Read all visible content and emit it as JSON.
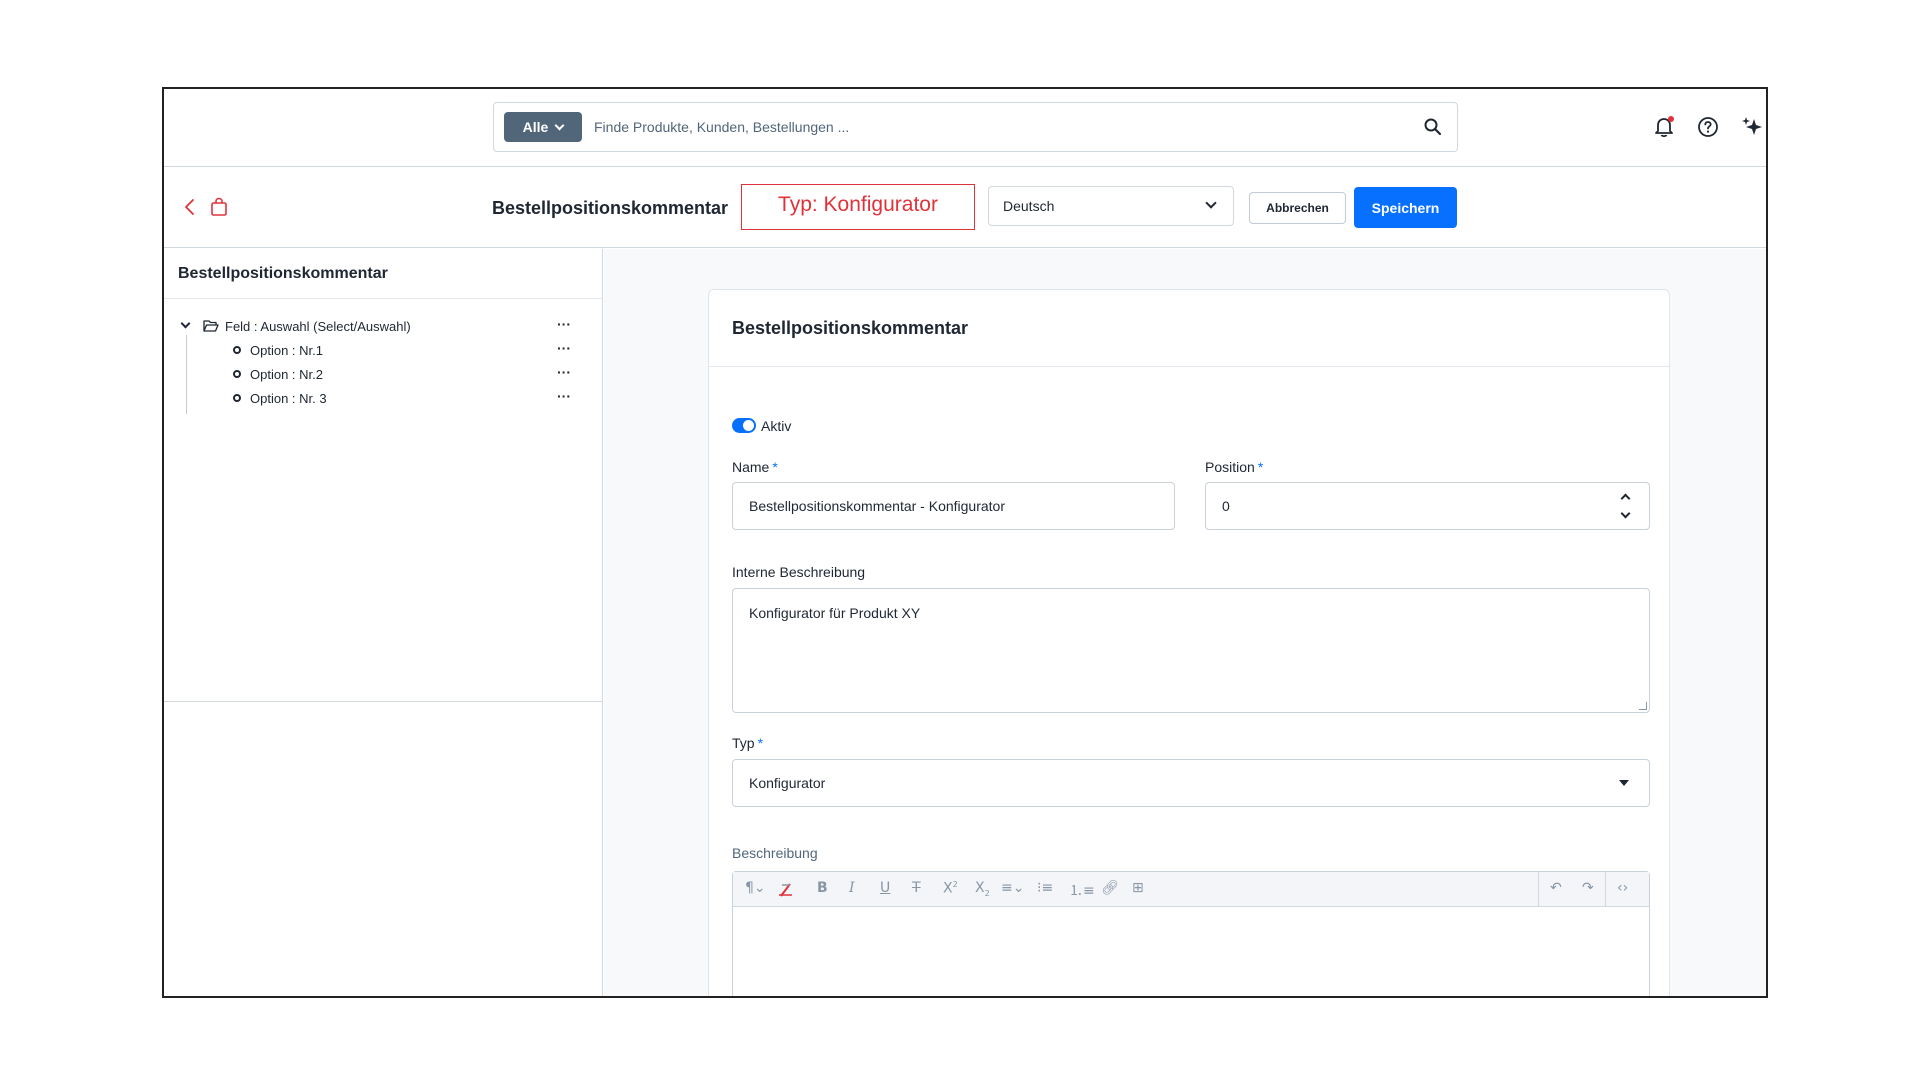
{
  "search": {
    "category_label": "Alle",
    "placeholder": "Finde Produkte, Kunden, Bestellungen ..."
  },
  "header": {
    "title": "Bestellpositionskommentar",
    "annotation": "Typ: Konfigurator",
    "language": "Deutsch",
    "cancel_label": "Abbrechen",
    "save_label": "Speichern"
  },
  "tree": {
    "title": "Bestellpositionskommentar",
    "root": {
      "label": "Feld : Auswahl (Select/Auswahl)",
      "menu": "···"
    },
    "options": [
      {
        "label": "Option : Nr.1",
        "menu": "···"
      },
      {
        "label": "Option : Nr.2",
        "menu": "···"
      },
      {
        "label": "Option : Nr. 3",
        "menu": "···"
      }
    ]
  },
  "form": {
    "card_title": "Bestellpositionskommentar",
    "active_label": "Aktiv",
    "active": true,
    "name_label": "Name",
    "name_value": "Bestellpositionskommentar - Konfigurator",
    "position_label": "Position",
    "position_value": "0",
    "description_internal_label": "Interne Beschreibung",
    "description_internal_value": "Konfigurator für Produkt XY",
    "type_label": "Typ",
    "type_value": "Konfigurator",
    "description_label": "Beschreibung",
    "required_marker": "*"
  },
  "colors": {
    "primary": "#0870ff",
    "annotation": "#e0323a",
    "category_bg": "#52667a",
    "notification_dot": "#e0323a"
  }
}
